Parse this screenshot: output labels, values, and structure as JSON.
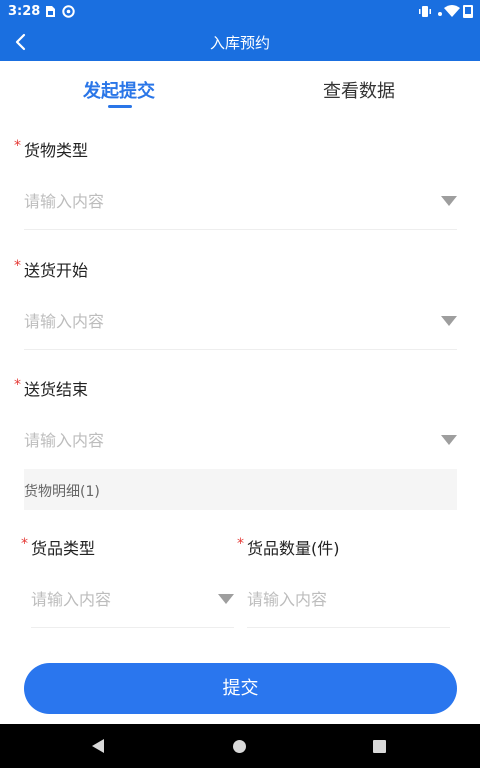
{
  "status_bar": {
    "time": "3:28",
    "icons": [
      "sim-icon",
      "at-icon",
      "vibrate-icon",
      "wifi-icon",
      "signal-icon",
      "battery-icon"
    ]
  },
  "app_bar": {
    "title": "入库预约",
    "back_icon": "chevron-left-icon"
  },
  "tabs": [
    {
      "label": "发起提交",
      "active": true
    },
    {
      "label": "查看数据",
      "active": false
    }
  ],
  "form": {
    "goods_type": {
      "label": "货物类型",
      "placeholder": "请输入内容",
      "required": true
    },
    "delivery_start": {
      "label": "送货开始",
      "placeholder": "请输入内容",
      "required": true
    },
    "delivery_end": {
      "label": "送货结束",
      "placeholder": "请输入内容",
      "required": true
    },
    "detail_header": "货物明细(1)",
    "item_type": {
      "label": "货品类型",
      "placeholder": "请输入内容",
      "required": true
    },
    "item_quantity": {
      "label": "货品数量(件)",
      "placeholder": "请输入内容",
      "required": true
    },
    "required_mark": "*"
  },
  "submit_label": "提交",
  "colors": {
    "primary": "#1a6fe0",
    "tab_active": "#2a76e8",
    "required": "#e53935",
    "placeholder": "#bdbdbd"
  }
}
